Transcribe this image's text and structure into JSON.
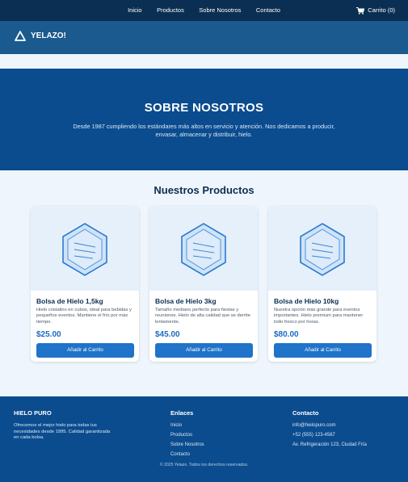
{
  "nav": {
    "links": [
      "Inicio",
      "Productos",
      "Sobre Nosotros",
      "Contacto"
    ],
    "cart_label": "Carrito (0)",
    "cart_icon": "cart-icon"
  },
  "brand": {
    "name": "YELAZO!",
    "logo_icon": "triangle-logo-icon"
  },
  "hero": {
    "title": "SOBRE NOSOTROS",
    "text": "Desde 1987 cumpliendo los estándares más altos en servicio y atención. Nos dedicamos a producir, envasar, almacenar y distribuir, hielo."
  },
  "products": {
    "title": "Nuestros Productos",
    "items": [
      {
        "name": "Bolsa de Hielo 1,5kg",
        "desc": "Hielo cristalino en cubos, ideal para bebidas y pequeños eventos. Mantiene el frío por más tiempo.",
        "price": "$25.00",
        "button": "Añadir al Carrito"
      },
      {
        "name": "Bolsa de Hielo 3kg",
        "desc": "Tamaño mediano perfecto para fiestas y reuniones. Hielo de alta calidad que se derrite lentamente.",
        "price": "$45.00",
        "button": "Añadir al Carrito"
      },
      {
        "name": "Bolsa de Hielo 10kg",
        "desc": "Nuestra opción más grande para eventos importantes. Hielo premium para mantener todo fresco por horas.",
        "price": "$80.00",
        "button": "Añadir al Carrito"
      }
    ]
  },
  "footer": {
    "brand_title": "HIELO PURO",
    "brand_text": "Ofrecemos el mejor hielo para todas tus necesidades desde 1995. Calidad garantizada en cada bolsa.",
    "links_title": "Enlaces",
    "links": [
      "Inicio",
      "Productos",
      "Sobre Nosotros",
      "Contacto"
    ],
    "contact_title": "Contacto",
    "contact": [
      "info@hielopuro.com",
      "+52 (555) 123-4567",
      "Av. Refrigeración 123, Ciudad Fría"
    ],
    "copyright": "© 2025 Yelazo. Todos los derechos reservados."
  },
  "colors": {
    "nav_bg": "#0b2f52",
    "brand_bg": "#1b5a8e",
    "hero_bg": "#0b4c8f",
    "accent": "#1f73c9"
  }
}
